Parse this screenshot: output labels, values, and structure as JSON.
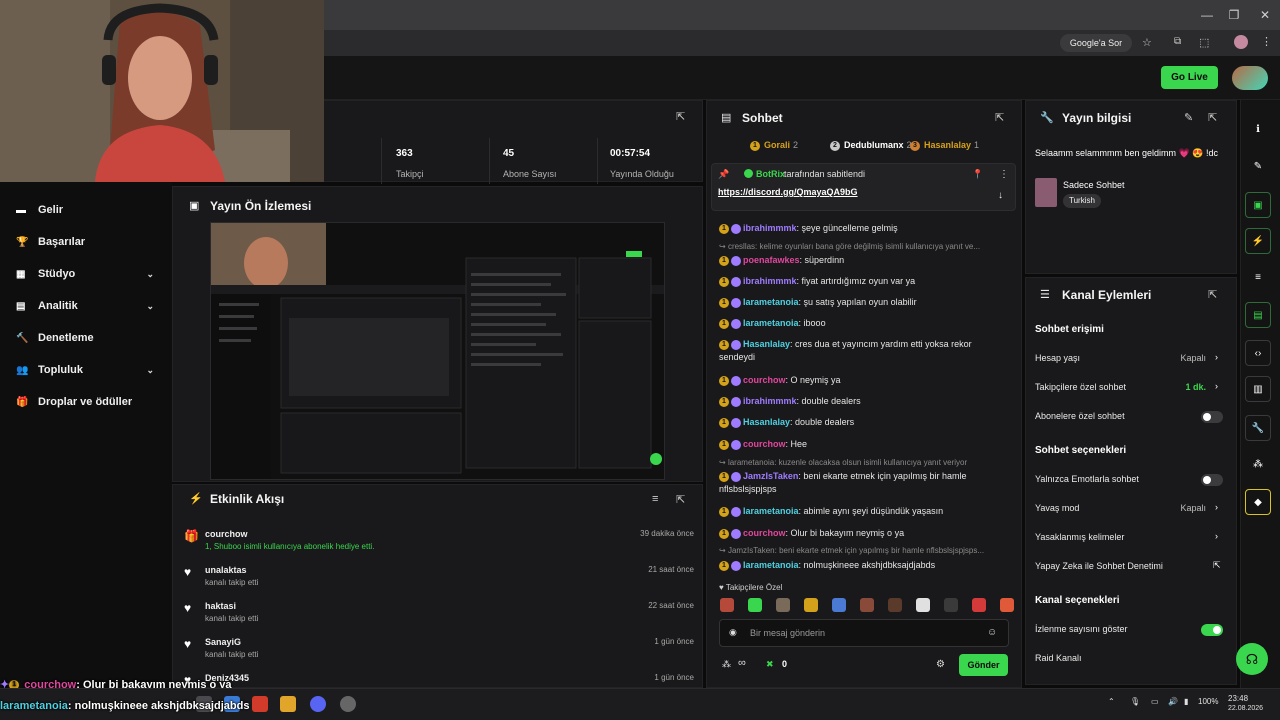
{
  "browser": {
    "google_btn": "Google'a Sor"
  },
  "topbar": {
    "go_live": "Go Live"
  },
  "sidebar": {
    "items": [
      {
        "label": "Gelir",
        "icon": "wallet-icon",
        "chev": false
      },
      {
        "label": "Başarılar",
        "icon": "trophy-icon",
        "chev": false
      },
      {
        "label": "Stüdyo",
        "icon": "studio-icon",
        "chev": true
      },
      {
        "label": "Analitik",
        "icon": "chart-icon",
        "chev": true
      },
      {
        "label": "Denetleme",
        "icon": "hammer-icon",
        "chev": false
      },
      {
        "label": "Topluluk",
        "icon": "community-icon",
        "chev": true
      },
      {
        "label": "Droplar ve ödüller",
        "icon": "gift-icon",
        "chev": false
      }
    ]
  },
  "stats": [
    {
      "value": "363",
      "label": "Takipçi"
    },
    {
      "value": "45",
      "label": "Abone Sayısı"
    },
    {
      "value": "00:57:54",
      "label": "Yayında Olduğu Süre"
    }
  ],
  "preview": {
    "title": "Yayın Ön İzlemesi"
  },
  "activity": {
    "title": "Etkinlik Akışı",
    "items": [
      {
        "name": "courchow",
        "sub": "1, Shuboo isimli kullanıcıya abonelik hediye etti.",
        "time": "39 dakika önce",
        "icon": "gift-icon"
      },
      {
        "name": "unalaktas",
        "sub": "kanalı takip etti",
        "time": "21 saat önce",
        "icon": "heart-icon"
      },
      {
        "name": "haktasi",
        "sub": "kanalı takip etti",
        "time": "22 saat önce",
        "icon": "heart-icon"
      },
      {
        "name": "SanayiG",
        "sub": "kanalı takip etti",
        "time": "1 gün önce",
        "icon": "heart-icon"
      },
      {
        "name": "Deniz4345",
        "sub": "",
        "time": "1 gün önce",
        "icon": "heart-icon"
      }
    ]
  },
  "chat": {
    "title": "Sohbet",
    "top_gifters": [
      {
        "rank": "1",
        "name": "Gorali",
        "count": "2",
        "color": "#d4a21a"
      },
      {
        "rank": "2",
        "name": "Dedublumanx",
        "count": "2",
        "color": "#c8c8c8"
      },
      {
        "rank": "3",
        "name": "Hasanlalay",
        "count": "1",
        "color": "#cd7f32"
      }
    ],
    "pinned": {
      "by": "BotRix",
      "by_suffix": "tarafından sabitlendi",
      "link": "https://discord.gg/QmayaQA9bG"
    },
    "messages": [
      {
        "user": "ibrahimmmk",
        "color": "#9f7cff",
        "text": "şeye güncelleme gelmiş",
        "reply": ""
      },
      {
        "user": "",
        "color": "",
        "text": "",
        "reply": "cresllas: kelime oyunları bana göre değilmiş isimli kullanıcıya yanıt ve..."
      },
      {
        "user": "poenafawkes",
        "color": "#e0479e",
        "text": "süperdinn",
        "reply": ""
      },
      {
        "user": "ibrahimmmk",
        "color": "#9f7cff",
        "text": "fiyat artırdığımız oyun var ya",
        "reply": ""
      },
      {
        "user": "larametanoia",
        "color": "#4fd0e0",
        "text": "şu satış yapılan oyun olabilir",
        "reply": ""
      },
      {
        "user": "larametanoia",
        "color": "#4fd0e0",
        "text": "ibooo",
        "reply": ""
      },
      {
        "user": "Hasanlalay",
        "color": "#4fd0e0",
        "text": "cres dua et yayıncım yardım etti yoksa rekor sendeydi",
        "reply": ""
      },
      {
        "user": "courchow",
        "color": "#e0479e",
        "text": "O neymiş ya",
        "reply": ""
      },
      {
        "user": "ibrahimmmk",
        "color": "#9f7cff",
        "text": "double dealers",
        "reply": ""
      },
      {
        "user": "Hasanlalay",
        "color": "#4fd0e0",
        "text": "double dealers",
        "reply": ""
      },
      {
        "user": "courchow",
        "color": "#e0479e",
        "text": "Hee",
        "reply": ""
      },
      {
        "user": "",
        "color": "",
        "text": "",
        "reply": "larametanoia: kuzenle olacaksa olsun isimli kullanıcıya yanıt veriyor"
      },
      {
        "user": "JamzIsTaken",
        "color": "#9f7cff",
        "text": "beni ekarte etmek için yapılmış bir hamle nflsbslsjspjsps",
        "reply": ""
      },
      {
        "user": "larametanoia",
        "color": "#4fd0e0",
        "text": "abimle aynı şeyi düşündük yaşasın",
        "reply": ""
      },
      {
        "user": "courchow",
        "color": "#e0479e",
        "text": "Olur bi bakayım neymiş o ya",
        "reply": ""
      },
      {
        "user": "",
        "color": "",
        "text": "",
        "reply": "JamzIsTaken: beni ekarte etmek için yapılmış bir hamle nflsbslsjspjsps..."
      },
      {
        "user": "larametanoia",
        "color": "#4fd0e0",
        "text": "nolmuşkineee akshjdbksajdjabds",
        "reply": ""
      }
    ],
    "followers_only": "Takipçilere Özel",
    "input_placeholder": "Bir mesaj gönderin",
    "infinity": "∞",
    "points": "0",
    "send": "Gönder"
  },
  "stream_info": {
    "title": "Yayın bilgisi",
    "stream_title": "Selaamm selammmm ben geldimm 💗 😍 !dc",
    "category": "Sadece Sohbet",
    "tag": "Turkish"
  },
  "channel_actions": {
    "title": "Kanal Eylemleri",
    "sections": [
      {
        "header": "Sohbet erişimi",
        "rows": [
          {
            "label": "Hesap yaşı",
            "value": "Kapalı",
            "kind": "chevron"
          },
          {
            "label": "Takipçilere özel sohbet",
            "value": "1 dk.",
            "kind": "chevron-green"
          },
          {
            "label": "Abonelere özel sohbet",
            "value": "",
            "kind": "toggle-off"
          }
        ]
      },
      {
        "header": "Sohbet seçenekleri",
        "rows": [
          {
            "label": "Yalnızca Emotlarla sohbet",
            "value": "",
            "kind": "toggle-off"
          },
          {
            "label": "Yavaş mod",
            "value": "Kapalı",
            "kind": "chevron"
          },
          {
            "label": "Yasaklanmış kelimeler",
            "value": "",
            "kind": "chevron"
          },
          {
            "label": "Yapay Zeka ile Sohbet Denetimi",
            "value": "",
            "kind": "external"
          }
        ]
      },
      {
        "header": "Kanal seçenekleri",
        "rows": [
          {
            "label": "İzlenme sayısını göster",
            "value": "",
            "kind": "toggle-on"
          },
          {
            "label": "Raid Kanalı",
            "value": "",
            "kind": "none"
          }
        ]
      }
    ]
  },
  "overlay": [
    {
      "user": "courchow",
      "color": "#e0479e",
      "text": ": Olur bi bakayım neymiş o ya"
    },
    {
      "user": "larametanoia",
      "color": "#4fd0e0",
      "text": ": nolmuşkineee akshjdbksajdjabds"
    }
  ],
  "taskbar": {
    "battery": "100%",
    "time": "23:48",
    "date": "22.08.2026"
  }
}
